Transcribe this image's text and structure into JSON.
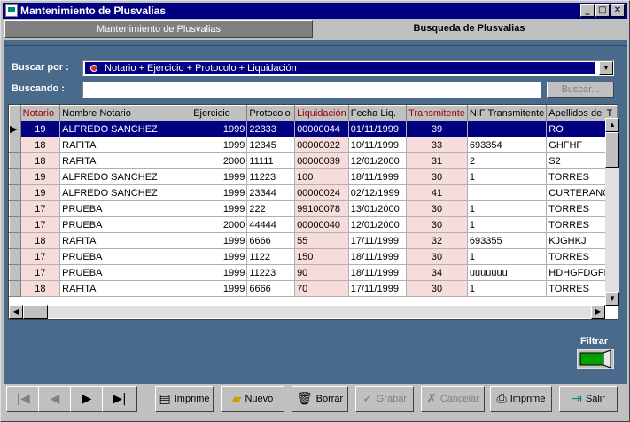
{
  "window": {
    "title": "Mantenimiento de Plusvalias"
  },
  "tabs": [
    {
      "label": "Mantenimiento de Plusvalias"
    },
    {
      "label": "Busqueda de Plusvalias"
    }
  ],
  "search": {
    "buscar_por_label": "Buscar por :",
    "buscar_por_value": "Notario + Ejercicio + Protocolo + Liquidación",
    "buscando_label": "Buscando :",
    "buscando_value": "",
    "buscar_button": "Buscar..."
  },
  "grid": {
    "columns": [
      "Notario",
      "Nombre Notario",
      "Ejercicio",
      "Protocolo",
      "Liquidación",
      "Fecha Liq.",
      "Transmitente",
      "NIF Transmitente",
      "Apellidos del T"
    ],
    "rows": [
      [
        "19",
        "ALFREDO SANCHEZ",
        "1999",
        "22333",
        "00000044",
        "01/11/1999",
        "39",
        "",
        "RO"
      ],
      [
        "18",
        "RAFITA",
        "1999",
        "12345",
        "00000022",
        "10/11/1999",
        "33",
        "693354",
        "GHFHF"
      ],
      [
        "18",
        "RAFITA",
        "2000",
        "11111",
        "00000039",
        "12/01/2000",
        "31",
        "2",
        "S2"
      ],
      [
        "19",
        "ALFREDO SANCHEZ",
        "1999",
        "11223",
        "100",
        "18/11/1999",
        "30",
        "1",
        "TORRES"
      ],
      [
        "19",
        "ALFREDO SANCHEZ",
        "1999",
        "23344",
        "00000024",
        "02/12/1999",
        "41",
        "",
        "CURTERANO"
      ],
      [
        "17",
        "PRUEBA",
        "1999",
        "222",
        "99100078",
        "13/01/2000",
        "30",
        "1",
        "TORRES"
      ],
      [
        "17",
        "PRUEBA",
        "2000",
        "44444",
        "00000040",
        "12/01/2000",
        "30",
        "1",
        "TORRES"
      ],
      [
        "18",
        "RAFITA",
        "1999",
        "6666",
        "55",
        "17/11/1999",
        "32",
        "693355",
        "KJGHKJ"
      ],
      [
        "17",
        "PRUEBA",
        "1999",
        "1122",
        "150",
        "18/11/1999",
        "30",
        "1",
        "TORRES"
      ],
      [
        "17",
        "PRUEBA",
        "1999",
        "11223",
        "90",
        "18/11/1999",
        "34",
        "uuuuuuu",
        "HDHGFDGFD"
      ],
      [
        "18",
        "RAFITA",
        "1999",
        "6666",
        "70",
        "17/11/1999",
        "30",
        "1",
        "TORRES"
      ]
    ]
  },
  "filtrar": {
    "label": "Filtrar"
  },
  "toolbar": {
    "imprime1": "Imprime",
    "nuevo": "Nuevo",
    "borrar": "Borrar",
    "grabar": "Grabar",
    "cancelar": "Cancelar",
    "imprime2": "Imprime",
    "salir": "Salir"
  }
}
